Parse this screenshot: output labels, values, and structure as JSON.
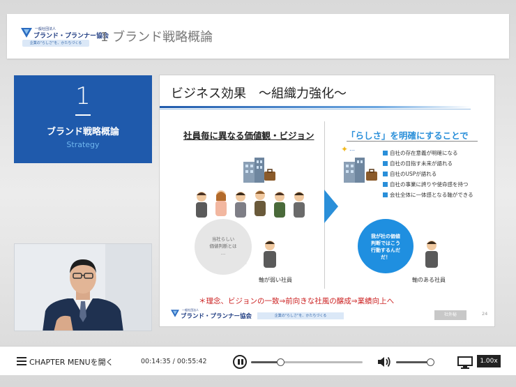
{
  "header": {
    "logo_small_text": "一般社団法人",
    "logo_name": "ブランド・プランナー協会",
    "logo_tagline": "企業の\"らしさ\"を、かたちづくる",
    "course_title": "1 ブランド戦略概論"
  },
  "chapter": {
    "number": "1",
    "title": "ブランド戦略概論",
    "subtitle": "Strategy"
  },
  "slide": {
    "title": "ビジネス効果　～組織力強化～",
    "left_heading": "社員毎に異なる価値観・ビジョン",
    "right_heading": "「らしさ」を明確にすることで",
    "bullets": [
      "自社の存在意義が明確になる",
      "自社の目指す未来が語れる",
      "自社のUSPが語れる",
      "自社の事業に誇りや使命感を持つ",
      "会社全体に一体感となる軸ができる"
    ],
    "grey_bubble": [
      "当社らしい",
      "価値判断とは",
      "…"
    ],
    "blue_bubble": [
      "我が社の価値",
      "判断ではこう",
      "行動するんだ",
      "だ！"
    ],
    "caption_left": "軸が弱い社員",
    "caption_right": "軸のある社員",
    "note": "＊理念、ビジョンの一致⇒前向きな社風の醸成⇒業績向上へ",
    "footer_logo_small": "一般社団法人",
    "footer_logo_name": "ブランド・プランナー協会",
    "footer_tagline": "企業の\"らしさ\"を、かたちづくる",
    "confidential_label": "社外秘",
    "page_number": "24"
  },
  "controls": {
    "menu_label": "CHAPTER MENUを開く",
    "time": "00:14:35 / 00:55:42",
    "progress": 0.26,
    "volume": 0.9,
    "speed": "1.00x"
  },
  "colors": {
    "brand_blue": "#1f5aac",
    "accent_blue": "#2a8fd9",
    "note_red": "#cc2222"
  }
}
